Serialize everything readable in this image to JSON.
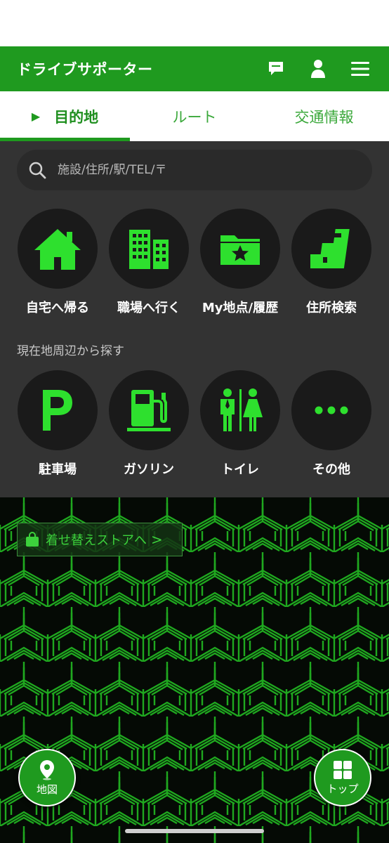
{
  "header": {
    "title": "ドライブサポーター",
    "icons": [
      "chat-icon",
      "user-icon",
      "menu-icon"
    ]
  },
  "tabs": [
    {
      "label": "目的地",
      "active": true
    },
    {
      "label": "ルート",
      "active": false
    },
    {
      "label": "交通情報",
      "active": false
    }
  ],
  "search": {
    "placeholder": "施設/住所/駅/TEL/〒"
  },
  "quick_actions": [
    {
      "label": "自宅へ帰る",
      "icon": "home-icon"
    },
    {
      "label": "職場へ行く",
      "icon": "office-icon"
    },
    {
      "label": "My地点/履歴",
      "icon": "folder-star-icon"
    },
    {
      "label": "住所検索",
      "icon": "address-icon"
    }
  ],
  "nearby": {
    "title": "現在地周辺から探す",
    "items": [
      {
        "label": "駐車場",
        "icon": "parking-icon"
      },
      {
        "label": "ガソリン",
        "icon": "fuel-icon"
      },
      {
        "label": "トイレ",
        "icon": "toilet-icon"
      },
      {
        "label": "その他",
        "icon": "more-icon"
      }
    ]
  },
  "store_button": {
    "label": "着せ替えストアへ",
    "chevron": ">"
  },
  "fabs": {
    "map_label": "地図",
    "top_label": "トップ"
  },
  "colors": {
    "primary": "#1f9a1f",
    "accent": "#29e029",
    "panel": "#333333",
    "circle": "#1a1a1a"
  }
}
